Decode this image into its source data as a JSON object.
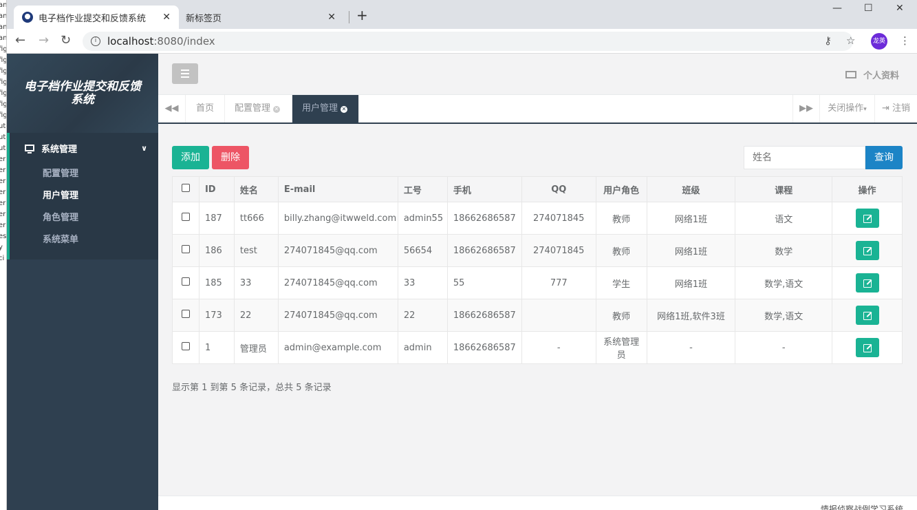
{
  "browser": {
    "active_tab_title": "电子档作业提交和反馈系统",
    "inactive_tab_title": "新标签页",
    "url_host": "localhost",
    "url_rest": ":8080/index",
    "profile_label": "龙英"
  },
  "sidebar": {
    "logo_text": "电子档作业提交和反馈系统",
    "section_label": "系统管理",
    "items": [
      {
        "label": "配置管理"
      },
      {
        "label": "用户管理"
      },
      {
        "label": "角色管理"
      },
      {
        "label": "系统菜单"
      }
    ]
  },
  "header": {
    "profile_label": "个人资料"
  },
  "tabs": {
    "items": [
      {
        "label": "首页"
      },
      {
        "label": "配置管理"
      },
      {
        "label": "用户管理"
      }
    ],
    "close_ops_label": "关闭操作",
    "logout_label": "注销"
  },
  "toolbar": {
    "add_label": "添加",
    "delete_label": "删除",
    "search_placeholder": "姓名",
    "search_label": "查询"
  },
  "table": {
    "columns": [
      "ID",
      "姓名",
      "E-mail",
      "工号",
      "手机",
      "QQ",
      "用户角色",
      "班级",
      "课程",
      "操作"
    ],
    "rows": [
      {
        "id": "187",
        "name": "tt666",
        "email": "billy.zhang@itwweld.com",
        "job_no": "admin55",
        "phone": "18662686587",
        "qq": "274071845",
        "role": "教师",
        "class": "网络1班",
        "course": "语文"
      },
      {
        "id": "186",
        "name": "test",
        "email": "274071845@qq.com",
        "job_no": "56654",
        "phone": "18662686587",
        "qq": "274071845",
        "role": "教师",
        "class": "网络1班",
        "course": "数学"
      },
      {
        "id": "185",
        "name": "33",
        "email": "274071845@qq.com",
        "job_no": "33",
        "phone": "55",
        "qq": "777",
        "role": "学生",
        "class": "网络1班",
        "course": "数学,语文"
      },
      {
        "id": "173",
        "name": "22",
        "email": "274071845@qq.com",
        "job_no": "22",
        "phone": "18662686587",
        "qq": "",
        "role": "教师",
        "class": "网络1班,软件3班",
        "course": "数学,语文"
      },
      {
        "id": "1",
        "name": "管理员",
        "email": "admin@example.com",
        "job_no": "admin",
        "phone": "18662686587",
        "qq": "-",
        "role": "系统管理员",
        "class": "-",
        "course": "-"
      }
    ]
  },
  "summary": "显示第 1 到第 5 条记录，总共 5 条记录",
  "footer_text": "情报侦察战例学习系统",
  "colors": {
    "primary": "#1ab394",
    "danger": "#ed5565",
    "info": "#1c84c6",
    "sidebar": "#2f4050"
  }
}
